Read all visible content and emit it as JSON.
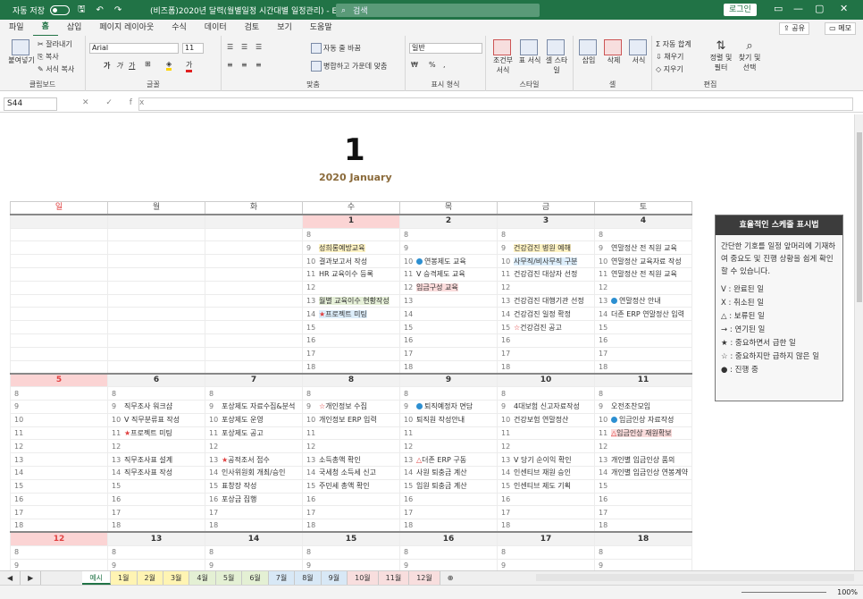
{
  "titlebar": {
    "autosave": "자동 저장",
    "doc_title": "(비즈폼)2020년 달력(월별일정 시간대별 일정관리) - Ex...",
    "search": "검색",
    "login": "로그인"
  },
  "tabs": [
    "파일",
    "홈",
    "삽입",
    "페이지 레이아웃",
    "수식",
    "데이터",
    "검토",
    "보기",
    "도움말"
  ],
  "share": "공유",
  "memo": "메모",
  "ribbon": {
    "paste": "붙여넣기",
    "cut": "잘라내기",
    "copy": "복사",
    "format_painter": "서식 복사",
    "clipboard": "클립보드",
    "font_name": "Arial",
    "font_size": "11",
    "font_group": "글꼴",
    "wrap": "자동 줄 바꿈",
    "merge": "병합하고 가운데 맞춤",
    "align_group": "맞춤",
    "number_format": "일반",
    "number_group": "표시 형식",
    "cond": "조건부 서식",
    "table": "표 서식",
    "cellstyle": "셀 스타일",
    "style_group": "스타일",
    "insert": "삽입",
    "delete": "삭제",
    "format": "서식",
    "cell_group": "셀",
    "autosum": "자동 합계",
    "fill": "채우기",
    "clear": "지우기",
    "sort": "정렬 및 필터",
    "find": "찾기 및 선택",
    "edit_group": "편집"
  },
  "formula": {
    "namebox": "S44",
    "fx": "✕ ✓ fx"
  },
  "month": {
    "num": "1",
    "name": "2020 January"
  },
  "dow": [
    "일",
    "월",
    "화",
    "수",
    "목",
    "금",
    "토"
  ],
  "weeks": [
    {
      "days": [
        "",
        "",
        "",
        "1",
        "2",
        "3",
        "4"
      ],
      "rows": [
        [
          "",
          "",
          "",
          "8",
          "8",
          "8",
          "8"
        ],
        [
          "",
          "",
          "",
          "9|성희롱예방교육|y",
          "9",
          "9|건강검진 병원 예해|y",
          "9|연말정산 전 직원 교육"
        ],
        [
          "",
          "",
          "",
          "10|결과보고서 작성",
          "10|●연봉제도 교육",
          "10|사무직/비사무직 구분|b",
          "10|연말정산 교육자료 작성"
        ],
        [
          "",
          "",
          "",
          "11|HR 교육이수 등록",
          "11|V 승격제도 교육",
          "11|건강검진 대상자 선정",
          "11|연말정산 전 직원 교육"
        ],
        [
          "",
          "",
          "",
          "12",
          "12|임금구성 교육|p",
          "12",
          "12"
        ],
        [
          "",
          "",
          "",
          "13|월별 교육이수 현황작성|g",
          "13",
          "13|건강검진 대행기관 선정",
          "13|●연말정산 안내"
        ],
        [
          "",
          "",
          "",
          "14|★프로젝트 미팅|b",
          "14",
          "14|건강검진 일정 확정",
          "14|더존 ERP 연말정산 입력"
        ],
        [
          "",
          "",
          "",
          "15",
          "15",
          "15|☆건강검진 공고",
          "15"
        ],
        [
          "",
          "",
          "",
          "16",
          "16",
          "16",
          "16"
        ],
        [
          "",
          "",
          "",
          "17",
          "17",
          "17",
          "17"
        ],
        [
          "",
          "",
          "",
          "18",
          "18",
          "18",
          "18"
        ]
      ]
    },
    {
      "days": [
        "5",
        "6",
        "7",
        "8",
        "9",
        "10",
        "11"
      ],
      "rows": [
        [
          "8",
          "8",
          "8",
          "8",
          "8",
          "8",
          "8"
        ],
        [
          "9",
          "9|직무조사 워크샵",
          "9|포상제도 자료수집&분석",
          "9|☆개인정보 수집",
          "9|●퇴직예정자 면담",
          "9|4대보험 신고자료작성",
          "9|오전조찬모임"
        ],
        [
          "10",
          "10|V 직무분류표 작성",
          "10|포상제도 운영",
          "10|개인정보 ERP 입력",
          "10|퇴직원 작성안내",
          "10|건강보험 연말정산",
          "10|●임금인상 자료작성"
        ],
        [
          "11",
          "11|★프로젝트 미팅",
          "11|포상제도 공고",
          "11",
          "11",
          "11",
          "11|△임금인상 재원확보|p"
        ],
        [
          "12",
          "12",
          "12",
          "12",
          "12",
          "12",
          "12"
        ],
        [
          "13",
          "13|직무조사표 설계",
          "13|★공적조서 접수",
          "13|소득총액 확인",
          "13|△더존 ERP 구동",
          "13|V 당기 순이익 확인",
          "13|개인별 임금인상 품의"
        ],
        [
          "14",
          "14|직무조사표 작성",
          "14|인사위원회 개최/승인",
          "14|국세청 소득세 신고",
          "14|사원 퇴충금 계산",
          "14|인센티브 재원 승인",
          "14|개인별 임금인상 연봉계약"
        ],
        [
          "15",
          "15",
          "15|표창장 작성",
          "15|주민세 총액 확인",
          "15|임원 퇴충금 계산",
          "15|인센티브 제도 기획",
          "15"
        ],
        [
          "16",
          "16",
          "16|포상금 집행",
          "16",
          "16",
          "16",
          "16"
        ],
        [
          "17",
          "17",
          "17",
          "17",
          "17",
          "17",
          "17"
        ],
        [
          "18",
          "18",
          "18",
          "18",
          "18",
          "18",
          "18"
        ]
      ]
    },
    {
      "days": [
        "12",
        "13",
        "14",
        "15",
        "16",
        "17",
        "18"
      ],
      "rows": [
        [
          "8",
          "8",
          "8",
          "8",
          "8",
          "8",
          "8"
        ],
        [
          "9",
          "9",
          "9",
          "9",
          "9",
          "9",
          "9"
        ]
      ]
    }
  ],
  "legend": {
    "title": "효율적인 스케줄 표시법",
    "intro": "간단한 기호를 일정 앞머리에 기재하여 중요도 및 진행 상황을 쉽게 확인할 수 있습니다.",
    "items": [
      "V : 완료된 일",
      "X : 취소된 일",
      "△ : 보류된 일",
      "→ : 연기된 일",
      "★ : 중요하면서 급한 일",
      "☆ : 중요하지만 급하지 않은 일",
      "● : 진행 중"
    ]
  },
  "sheets": [
    "예시",
    "1월",
    "2월",
    "3월",
    "4월",
    "5월",
    "6월",
    "7월",
    "8월",
    "9월",
    "10월",
    "11월",
    "12월"
  ],
  "sheet_colors": [
    "#fff",
    "#fff4b3",
    "#fff4b3",
    "#fff4b3",
    "#e4f0d4",
    "#e4f0d4",
    "#e4f0d4",
    "#d8e8f6",
    "#d8e8f6",
    "#d8e8f6",
    "#f8dede",
    "#f8dede",
    "#f8dede"
  ],
  "status": {
    "zoom": "100%"
  }
}
